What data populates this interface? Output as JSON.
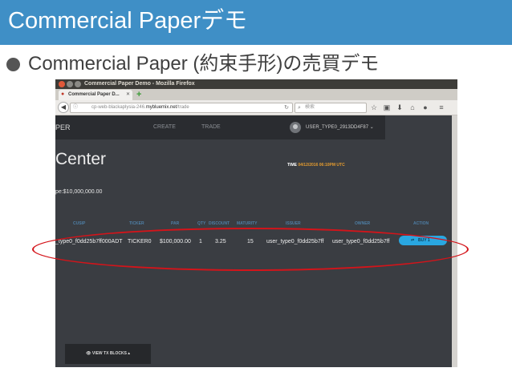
{
  "slide": {
    "title": "Commercial Paperデモ",
    "bullet": "Commercial Paper (約束手形)の売買デモ"
  },
  "browser": {
    "window_title": "Commercial Paper Demo - Mozilla Firefox",
    "tab_label": "Commercial Paper D...",
    "tab_close": "✕",
    "new_tab": "+",
    "url_prefix": "cp-web-blackaplysia-246.",
    "url_host": "mybluemix.net",
    "url_path": "/trade",
    "search_placeholder": "検索",
    "toolbar_icons": [
      "star-icon",
      "clipboard-icon",
      "download-icon",
      "home-icon",
      "chat-icon",
      "menu-icon"
    ]
  },
  "app": {
    "brand": "PER",
    "nav": {
      "create": "CREATE",
      "trade": "TRADE"
    },
    "user": "USER_TYPE0_2913DD4F87 ⌄",
    "page_title": "Center",
    "time_label": "TIME",
    "time_value": "04/12/2016 06:10PM UTC",
    "par_text": "pe:$10,000,000.00",
    "table": {
      "headers": [
        "CUSIP",
        "TICKER",
        "PAR",
        "QTY",
        "DISCOUNT",
        "MATURITY",
        "ISSUER",
        "OWNER",
        "ACTION"
      ],
      "row": {
        "cusip": "_type0_f0dd25b7ff000ADT",
        "ticker": "TICKER0",
        "par": "$100,000.00",
        "qty": "1",
        "discount": "3.25",
        "maturity": "15",
        "issuer": "user_type0_f0dd25b7ff",
        "owner": "user_type0_f0dd25b7ff"
      },
      "buy_label": "BUY 1"
    },
    "tx_blocks_label": "👁 VIEW TX BLOCKS ▴"
  },
  "colors": {
    "slide_header": "#3f8fc6",
    "app_background": "#3a3d42",
    "app_navbar": "#2a2c30",
    "buy_button": "#29a7e1",
    "time_value": "#e39b2f",
    "highlight_ellipse": "#d4141a"
  }
}
